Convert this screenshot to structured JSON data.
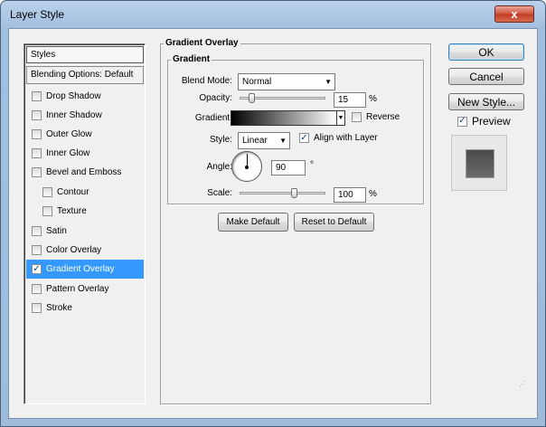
{
  "window": {
    "title": "Layer Style",
    "close_glyph": "x"
  },
  "styles_list": {
    "header": "Styles",
    "blending_options": "Blending Options: Default",
    "items": [
      {
        "label": "Drop Shadow",
        "checked": false
      },
      {
        "label": "Inner Shadow",
        "checked": false
      },
      {
        "label": "Outer Glow",
        "checked": false
      },
      {
        "label": "Inner Glow",
        "checked": false
      },
      {
        "label": "Bevel and Emboss",
        "checked": false
      },
      {
        "label": "Contour",
        "checked": false
      },
      {
        "label": "Texture",
        "checked": false
      },
      {
        "label": "Satin",
        "checked": false
      },
      {
        "label": "Color Overlay",
        "checked": false
      },
      {
        "label": "Gradient Overlay",
        "checked": true
      },
      {
        "label": "Pattern Overlay",
        "checked": false
      },
      {
        "label": "Stroke",
        "checked": false
      }
    ],
    "selected": "Gradient Overlay"
  },
  "gradient_overlay": {
    "group_title": "Gradient Overlay",
    "subgroup_title": "Gradient",
    "blend_mode_label": "Blend Mode:",
    "blend_mode_value": "Normal",
    "opacity_label": "Opacity:",
    "opacity_value": "15",
    "opacity_unit": "%",
    "opacity_level": 0.15,
    "gradient_label": "Gradient:",
    "gradient_from": "#000000",
    "gradient_to": "#ffffff",
    "reverse_label": "Reverse",
    "reverse_checked": false,
    "style_label": "Style:",
    "style_value": "Linear",
    "align_label": "Align with Layer",
    "align_checked": true,
    "angle_label": "Angle:",
    "angle_value": "90",
    "angle_unit": "°",
    "scale_label": "Scale:",
    "scale_value": "100",
    "scale_unit": "%",
    "make_default": "Make Default",
    "reset_default": "Reset to Default"
  },
  "actions": {
    "ok": "OK",
    "cancel": "Cancel",
    "new_style": "New Style...",
    "preview_label": "Preview",
    "preview_checked": true
  },
  "icons": {
    "check": "✓",
    "dropdown_arrow": "▼",
    "close": "close-icon"
  }
}
